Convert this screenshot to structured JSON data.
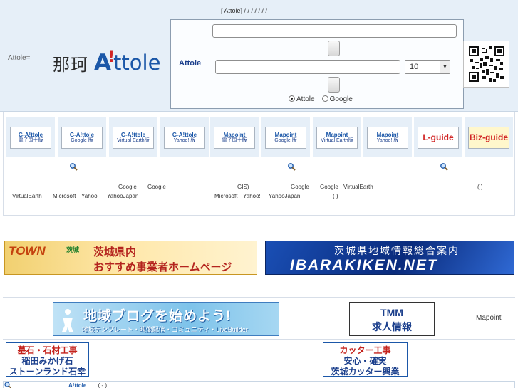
{
  "header": {
    "top_links": "[ Attole] / / / / / / /",
    "attole_eq": "Attole=",
    "logo": {
      "kanji": "那珂",
      "a": "A",
      "mark": "!",
      "rest": "ttole"
    }
  },
  "search": {
    "label": "Attole",
    "top_value": "",
    "main_value": "",
    "count_value": "10",
    "engines": [
      {
        "label": "Attole",
        "checked": true
      },
      {
        "label": "Google",
        "checked": false
      }
    ]
  },
  "services": {
    "tiles": [
      {
        "line1": "G-A!ttole",
        "line2": "電子国土版"
      },
      {
        "line1": "G-A!ttole",
        "line2": "Google 版"
      },
      {
        "line1": "G-A!ttole",
        "line2": "Virtual Earth版"
      },
      {
        "line1": "G-A!ttole",
        "line2": "Yahoo! 版"
      },
      {
        "line1": "Mapoint",
        "line2": "電子国土版"
      },
      {
        "line1": "Mapoint",
        "line2": "Google 版"
      },
      {
        "line1": "Mapoint",
        "line2": "Virtual Earth版"
      },
      {
        "line1": "Mapoint",
        "line2": "Yahoo! 版"
      },
      {
        "line1": "L-guide",
        "line2": ""
      },
      {
        "line1": "Biz-guide",
        "line2": ""
      }
    ],
    "texts": [
      {
        "text": "Google"
      },
      {
        "text": "Google"
      },
      {
        "text": "GIS)"
      },
      {
        "text": "Google"
      },
      {
        "text": "Google"
      },
      {
        "text": "VirtualEarth"
      },
      {
        "text": "( )"
      },
      {
        "text": "VirtualEarth"
      },
      {
        "text": "Microsoft"
      },
      {
        "text": "Yahoo!"
      },
      {
        "text": "YahooJapan"
      },
      {
        "text": "Microsoft"
      },
      {
        "text": "Yahoo!"
      },
      {
        "text": "YahooJapan"
      },
      {
        "text": "( )"
      }
    ]
  },
  "ads": {
    "ibaraki": {
      "town": "TOWN",
      "sub": "茨城",
      "line1": "茨城県内",
      "line2": "おすすめ事業者ホームページ"
    },
    "ibarakiken": {
      "line1": "茨城県地域情報総合案内",
      "line2": "IBARAKIKEN.NET"
    },
    "blog": {
      "line1": "地域ブログを始めよう!",
      "line2": "地域テンプレート・映像配信・コミュニティ・LiveBuilder"
    },
    "tmm": {
      "line1": "TMM",
      "line2": "求人情報"
    },
    "mapoint": "Mapoint",
    "bosekii": {
      "line1": "墓石・石材工事",
      "line2": "稲田みかげ石",
      "line3": "ストーンランド石幸"
    },
    "cutter": {
      "line1": "カッター工事",
      "line2": "安心・確実",
      "line3": "茨城カッター興業"
    }
  },
  "footer": {
    "brand": "A!ttole",
    "text": "( - )"
  },
  "colors": {
    "brand_blue": "#1b57a8",
    "brand_red": "#d12424",
    "header_bg": "#e6eff8"
  }
}
